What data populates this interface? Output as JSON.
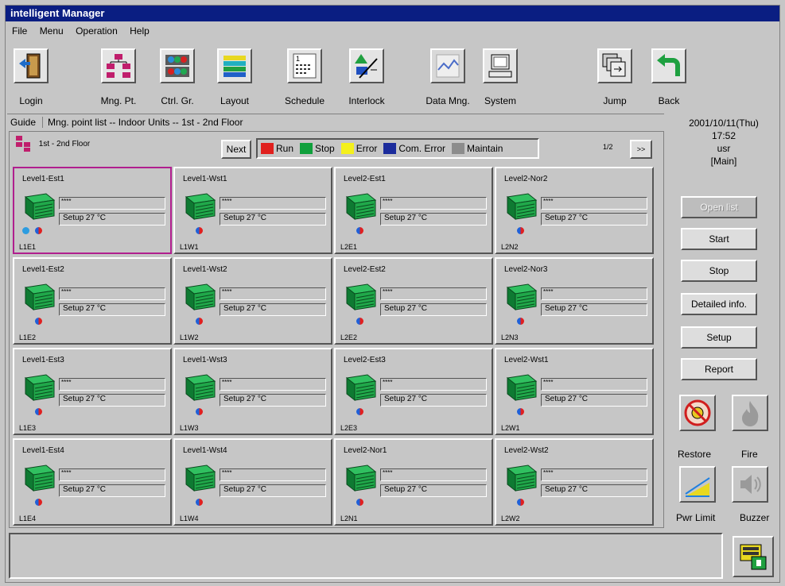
{
  "app": {
    "title": "intelligent Manager"
  },
  "menu": [
    "File",
    "Menu",
    "Operation",
    "Help"
  ],
  "toolbar": {
    "login": "Login",
    "mng_pt": "Mng. Pt.",
    "ctrl_gr": "Ctrl. Gr.",
    "layout": "Layout",
    "schedule": "Schedule",
    "interlock": "Interlock",
    "data_mng": "Data Mng.",
    "system": "System",
    "jump": "Jump",
    "back": "Back"
  },
  "guide": {
    "label": "Guide",
    "text": "Mng. point list -- Indoor Units -- 1st - 2nd Floor"
  },
  "panel": {
    "floor": "1st - 2nd Floor",
    "next": "Next",
    "page": "1/2",
    "page_next": ">>"
  },
  "legend": [
    {
      "label": "Run",
      "color": "#e0201e"
    },
    {
      "label": "Stop",
      "color": "#10a03c"
    },
    {
      "label": "Error",
      "color": "#f4f01c"
    },
    {
      "label": "Com. Error",
      "color": "#1c2c9c"
    },
    {
      "label": "Maintain",
      "color": "#8c8c8c"
    }
  ],
  "units": [
    {
      "name": "Level1-Est1",
      "code": "L1E1",
      "status": "****",
      "setup": "Setup 27 °C"
    },
    {
      "name": "Level1-Wst1",
      "code": "L1W1",
      "status": "****",
      "setup": "Setup 27 °C"
    },
    {
      "name": "Level2-Est1",
      "code": "L2E1",
      "status": "****",
      "setup": "Setup 27 °C"
    },
    {
      "name": "Level2-Nor2",
      "code": "L2N2",
      "status": "****",
      "setup": "Setup 27 °C"
    },
    {
      "name": "Level1-Est2",
      "code": "L1E2",
      "status": "****",
      "setup": "Setup 27 °C"
    },
    {
      "name": "Level1-Wst2",
      "code": "L1W2",
      "status": "****",
      "setup": "Setup 27 °C"
    },
    {
      "name": "Level2-Est2",
      "code": "L2E2",
      "status": "****",
      "setup": "Setup 27 °C"
    },
    {
      "name": "Level2-Nor3",
      "code": "L2N3",
      "status": "****",
      "setup": "Setup 27 °C"
    },
    {
      "name": "Level1-Est3",
      "code": "L1E3",
      "status": "****",
      "setup": "Setup 27 °C"
    },
    {
      "name": "Level1-Wst3",
      "code": "L1W3",
      "status": "****",
      "setup": "Setup 27 °C"
    },
    {
      "name": "Level2-Est3",
      "code": "L2E3",
      "status": "****",
      "setup": "Setup 27 °C"
    },
    {
      "name": "Level2-Wst1",
      "code": "L2W1",
      "status": "****",
      "setup": "Setup 27 °C"
    },
    {
      "name": "Level1-Est4",
      "code": "L1E4",
      "status": "****",
      "setup": "Setup 27 °C"
    },
    {
      "name": "Level1-Wst4",
      "code": "L1W4",
      "status": "****",
      "setup": "Setup 27 °C"
    },
    {
      "name": "Level2-Nor1",
      "code": "L2N1",
      "status": "****",
      "setup": "Setup 27 °C"
    },
    {
      "name": "Level2-Wst2",
      "code": "L2W2",
      "status": "****",
      "setup": "Setup 27 °C"
    }
  ],
  "side": {
    "date": "2001/10/11(Thu)",
    "time": "17:52",
    "user": "usr",
    "mode": "[Main]",
    "open_list": "Open list",
    "start": "Start",
    "stop": "Stop",
    "detailed": "Detailed info.",
    "setup": "Setup",
    "report": "Report",
    "restore": "Restore",
    "fire": "Fire",
    "pwr_limit": "Pwr Limit",
    "buzzer": "Buzzer"
  }
}
